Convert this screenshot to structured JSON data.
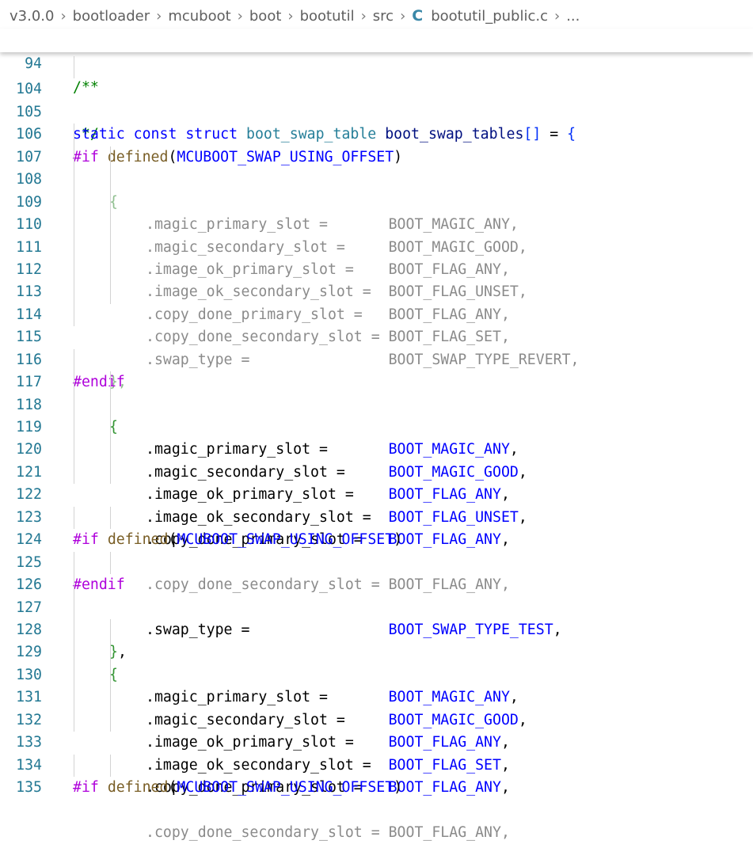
{
  "breadcrumb": {
    "items": [
      "v3.0.0",
      "bootloader",
      "mcuboot",
      "boot",
      "bootutil",
      "src"
    ],
    "file_icon": "C",
    "file": "bootutil_public.c",
    "ellipsis": "..."
  },
  "sticky": {
    "line": "94",
    "text": "/**"
  },
  "code": {
    "l104": {
      "num": "104",
      "text": " */"
    },
    "l105": {
      "num": "105",
      "kw": "static const struct",
      "type": "boot_swap_table",
      "name": "boot_swap_tables",
      "bracket": "[]",
      "rest": " = ",
      "brace": "{"
    },
    "l106": {
      "num": "106",
      "pp": "#if",
      "fn": "defined",
      "arg": "MCUBOOT_SWAP_USING_OFFSET"
    },
    "l107": {
      "num": "107",
      "text": "{"
    },
    "l108": {
      "num": "108",
      "text": ".magic_primary_slot =       BOOT_MAGIC_ANY,"
    },
    "l109": {
      "num": "109",
      "text": ".magic_secondary_slot =     BOOT_MAGIC_GOOD,"
    },
    "l110": {
      "num": "110",
      "text": ".image_ok_primary_slot =    BOOT_FLAG_ANY,"
    },
    "l111": {
      "num": "111",
      "text": ".image_ok_secondary_slot =  BOOT_FLAG_UNSET,"
    },
    "l112": {
      "num": "112",
      "text": ".copy_done_primary_slot =   BOOT_FLAG_ANY,"
    },
    "l113": {
      "num": "113",
      "text": ".copy_done_secondary_slot = BOOT_FLAG_SET,"
    },
    "l114": {
      "num": "114",
      "text": ".swap_type =                BOOT_SWAP_TYPE_REVERT,"
    },
    "l115": {
      "num": "115",
      "text": "},"
    },
    "l116": {
      "num": "116",
      "pp": "#endif"
    },
    "l117": {
      "num": "117",
      "brace": "{"
    },
    "l118": {
      "num": "118",
      "field": ".magic_primary_slot =       ",
      "value": "BOOT_MAGIC_ANY",
      "comma": ","
    },
    "l119": {
      "num": "119",
      "field": ".magic_secondary_slot =     ",
      "value": "BOOT_MAGIC_GOOD",
      "comma": ","
    },
    "l120": {
      "num": "120",
      "field": ".image_ok_primary_slot =    ",
      "value": "BOOT_FLAG_ANY",
      "comma": ","
    },
    "l121": {
      "num": "121",
      "field": ".image_ok_secondary_slot =  ",
      "value": "BOOT_FLAG_UNSET",
      "comma": ","
    },
    "l122": {
      "num": "122",
      "field": ".copy_done_primary_slot =   ",
      "value": "BOOT_FLAG_ANY",
      "comma": ","
    },
    "l123": {
      "num": "123",
      "pp": "#if",
      "fn": "defined",
      "arg": "MCUBOOT_SWAP_USING_OFFSET"
    },
    "l124": {
      "num": "124",
      "text": ".copy_done_secondary_slot = BOOT_FLAG_ANY,"
    },
    "l125": {
      "num": "125",
      "pp": "#endif"
    },
    "l126": {
      "num": "126",
      "field": ".swap_type =                ",
      "value": "BOOT_SWAP_TYPE_TEST",
      "comma": ","
    },
    "l127": {
      "num": "127",
      "brace": "}",
      "comma": ","
    },
    "l128": {
      "num": "128",
      "brace": "{"
    },
    "l129": {
      "num": "129",
      "field": ".magic_primary_slot =       ",
      "value": "BOOT_MAGIC_ANY",
      "comma": ","
    },
    "l130": {
      "num": "130",
      "field": ".magic_secondary_slot =     ",
      "value": "BOOT_MAGIC_GOOD",
      "comma": ","
    },
    "l131": {
      "num": "131",
      "field": ".image_ok_primary_slot =    ",
      "value": "BOOT_FLAG_ANY",
      "comma": ","
    },
    "l132": {
      "num": "132",
      "field": ".image_ok_secondary_slot =  ",
      "value": "BOOT_FLAG_SET",
      "comma": ","
    },
    "l133": {
      "num": "133",
      "field": ".copy_done_primary_slot =   ",
      "value": "BOOT_FLAG_ANY",
      "comma": ","
    },
    "l134": {
      "num": "134",
      "pp": "#if",
      "fn": "defined",
      "arg": "MCUBOOT_SWAP_USING_OFFSET"
    },
    "l135": {
      "num": "135",
      "text": ".copy_done_secondary_slot = BOOT_FLAG_ANY,"
    }
  },
  "colors": {
    "keyword": "#0000ff",
    "type": "#267f99",
    "identifier": "#001080",
    "preprocessor": "#af00db",
    "function": "#795e26",
    "comment": "#008000",
    "inactive": "#8b8b8b",
    "line_number": "#237893"
  }
}
